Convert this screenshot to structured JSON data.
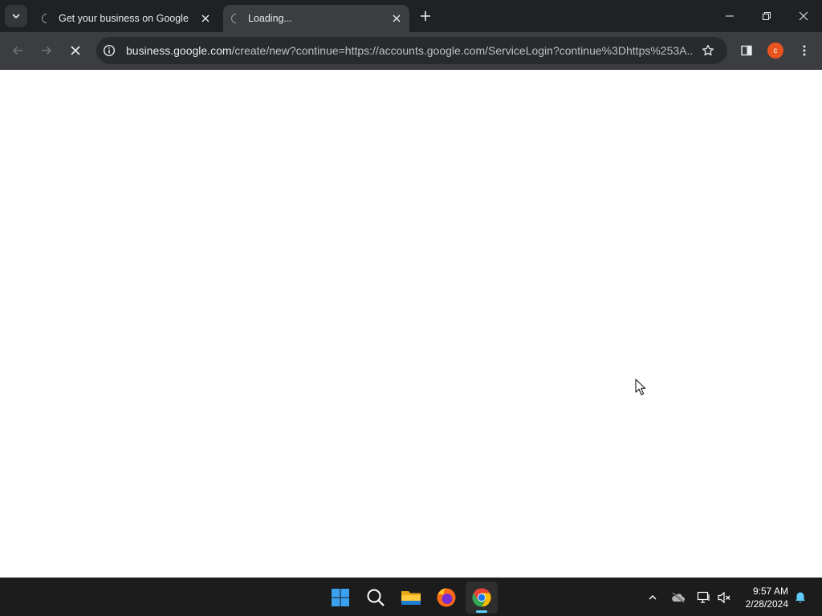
{
  "tabs": [
    {
      "title": "Get your business on Google",
      "state": "loading",
      "active": false
    },
    {
      "title": "Loading...",
      "state": "loading",
      "active": true
    }
  ],
  "window_controls": [
    "minimize-icon",
    "restore-icon",
    "close-icon"
  ],
  "toolbar": {
    "url_host": "business.google.com",
    "url_rest": "/create/new?continue=https://accounts.google.com/ServiceLogin?continue%3Dhttps%253A...",
    "profile_initial": "c",
    "reload_state": "stop"
  },
  "taskbar": {
    "apps": [
      "windows-start-icon",
      "search-icon",
      "file-explorer-icon",
      "firefox-icon",
      "chrome-icon"
    ],
    "active_app": "chrome-icon",
    "time": "9:57 AM",
    "date": "2/28/2024"
  },
  "colors": {
    "titlebar": "#202124",
    "toolbar": "#3c3d41",
    "omnibox": "#282a2d",
    "taskbar": "#1c1c1c",
    "accent": "#60cdff",
    "profile": "#e8541e"
  }
}
